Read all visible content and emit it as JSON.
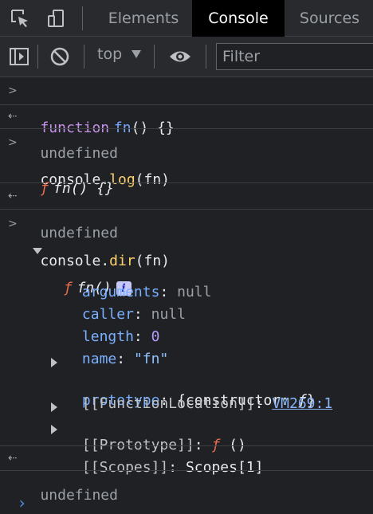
{
  "tabs": {
    "elements": "Elements",
    "console": "Console",
    "sources": "Sources"
  },
  "toolbar": {
    "context": "top",
    "filter_placeholder": "Filter"
  },
  "console": {
    "entry1": {
      "kw": "function",
      "name": "fn",
      "rest": "() {}"
    },
    "result1": "undefined",
    "entry2": {
      "obj": "console",
      "dot": ".",
      "method": "log",
      "args": "(fn)"
    },
    "log_output": {
      "f": "ƒ",
      "sig": "fn() {}"
    },
    "result2": "undefined",
    "entry3": {
      "obj": "console",
      "dot": ".",
      "method": "dir",
      "args": "(fn)"
    },
    "dir_header": {
      "f": "ƒ",
      "sig": "fn()",
      "badge": "i"
    },
    "props": {
      "arguments": {
        "key": "arguments",
        "colon": ": ",
        "value": "null"
      },
      "caller": {
        "key": "caller",
        "colon": ": ",
        "value": "null"
      },
      "length": {
        "key": "length",
        "colon": ": ",
        "value": "0"
      },
      "name": {
        "key": "name",
        "colon": ": ",
        "value": "\"fn\""
      },
      "prototype": {
        "key": "prototype",
        "colon": ": ",
        "pre": "{constructor: ",
        "f": "ƒ",
        "post": "}"
      },
      "function_location": {
        "key": "[[FunctionLocation]]",
        "colon": ": ",
        "link": "VM269:1"
      },
      "proto": {
        "key": "[[Prototype]]",
        "colon": ": ",
        "f": "ƒ",
        "post": " ()"
      },
      "scopes": {
        "key": "[[Scopes]]",
        "colon": ": ",
        "value": "Scopes[1]"
      }
    },
    "result3": "undefined",
    "input_prompt": "›"
  },
  "colors": {
    "background": "#202124",
    "accent": "#8ab4f8"
  }
}
